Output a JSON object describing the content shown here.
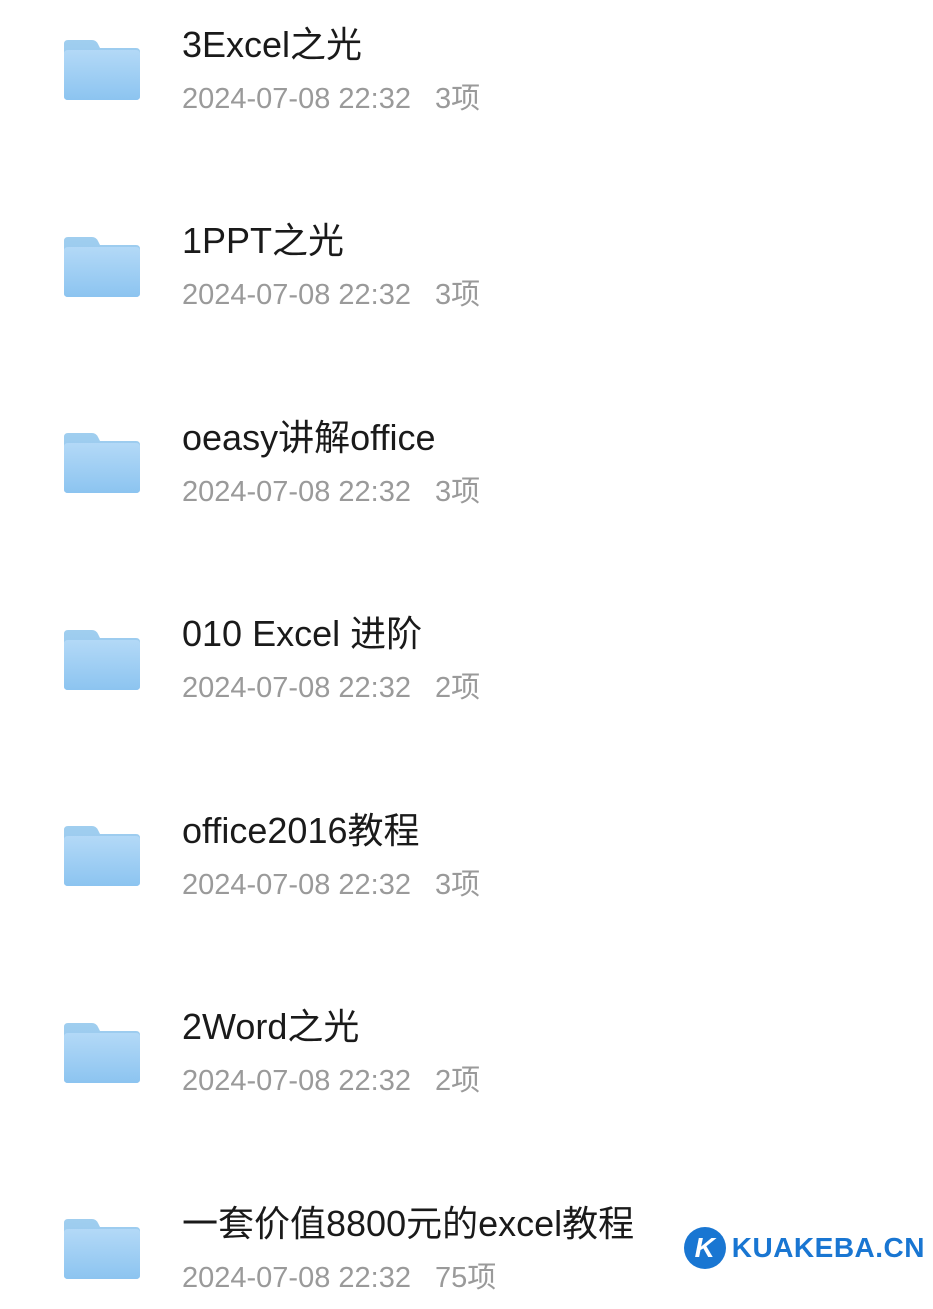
{
  "folders": [
    {
      "name": "3Excel之光",
      "date": "2024-07-08 22:32",
      "count": "3项"
    },
    {
      "name": "1PPT之光",
      "date": "2024-07-08 22:32",
      "count": "3项"
    },
    {
      "name": "oeasy讲解office",
      "date": "2024-07-08 22:32",
      "count": "3项"
    },
    {
      "name": "010 Excel 进阶",
      "date": "2024-07-08 22:32",
      "count": "2项"
    },
    {
      "name": "office2016教程",
      "date": "2024-07-08 22:32",
      "count": "3项"
    },
    {
      "name": "2Word之光",
      "date": "2024-07-08 22:32",
      "count": "2项"
    },
    {
      "name": "一套价值8800元的excel教程",
      "date": "2024-07-08 22:32",
      "count": "75项"
    }
  ],
  "watermark": {
    "logo_letter": "K",
    "text": "KUAKEBA.CN"
  }
}
